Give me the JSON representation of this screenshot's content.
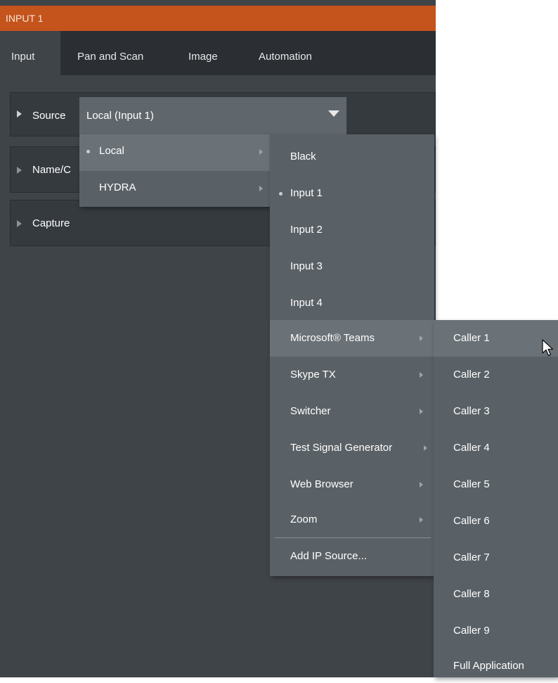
{
  "window": {
    "title": "INPUT 1"
  },
  "tabs": [
    {
      "label": "Input",
      "active": true
    },
    {
      "label": "Pan and Scan",
      "active": false
    },
    {
      "label": "Image",
      "active": false
    },
    {
      "label": "Automation",
      "active": false
    }
  ],
  "sections": {
    "source_label": "Source",
    "name_label": "Name/C",
    "capture_label": "Capture"
  },
  "source_select": {
    "value": "Local (Input 1)"
  },
  "menu_level1": {
    "items": [
      {
        "label": "Local",
        "selected": true,
        "submenu": true
      },
      {
        "label": "HYDRA",
        "selected": false,
        "submenu": true
      }
    ]
  },
  "menu_level2": {
    "items": [
      {
        "label": "Black"
      },
      {
        "label": "Input 1",
        "selected": true
      },
      {
        "label": "Input 2"
      },
      {
        "label": "Input 3"
      },
      {
        "label": "Input 4"
      },
      {
        "label": "Microsoft® Teams",
        "submenu": true,
        "highlighted": true
      },
      {
        "label": "Skype TX",
        "submenu": true
      },
      {
        "label": "Switcher",
        "submenu": true
      },
      {
        "label": "Test Signal Generator",
        "submenu": true
      },
      {
        "label": "Web Browser",
        "submenu": true
      },
      {
        "label": "Zoom",
        "submenu": true
      },
      {
        "label": "Add IP Source..."
      }
    ]
  },
  "menu_level3": {
    "items": [
      {
        "label": "Caller 1",
        "highlighted": true
      },
      {
        "label": "Caller 2"
      },
      {
        "label": "Caller 3"
      },
      {
        "label": "Caller 4"
      },
      {
        "label": "Caller 5"
      },
      {
        "label": "Caller 6"
      },
      {
        "label": "Caller 7"
      },
      {
        "label": "Caller 8"
      },
      {
        "label": "Caller 9"
      },
      {
        "label": "Full Application"
      }
    ]
  },
  "colors": {
    "title_bar": "#c4541c",
    "panel_bg": "#3f4448",
    "tab_bar": "#2b2f33",
    "menu_bg": "#5a6166",
    "menu_highlight": "#6b7277"
  }
}
